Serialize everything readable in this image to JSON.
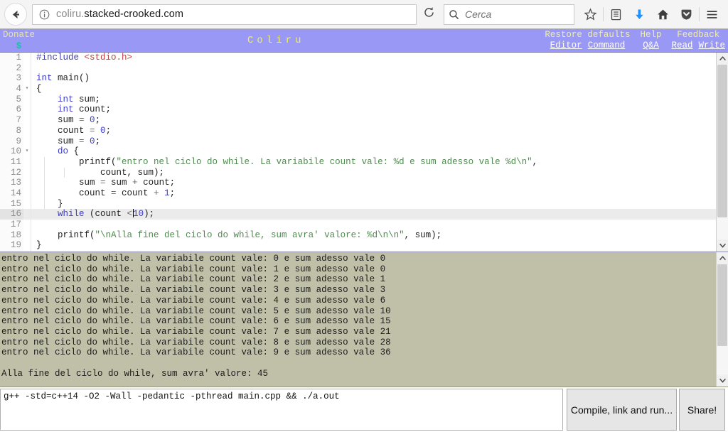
{
  "browser": {
    "back_title": "Back",
    "info_title": "Site information",
    "url_prefix": "coliru.",
    "url_domain": "stacked-crooked.com",
    "reload_title": "Reload",
    "search_placeholder": "Cerca",
    "icons": [
      {
        "name": "bookmark-star-icon",
        "title": "Bookmark this page"
      },
      {
        "name": "library-icon",
        "title": "Library"
      },
      {
        "name": "downloads-icon",
        "title": "Downloads"
      },
      {
        "name": "home-icon",
        "title": "Home"
      },
      {
        "name": "pocket-shield-icon",
        "title": "Save to Pocket"
      },
      {
        "name": "menu-hamburger-icon",
        "title": "Open menu"
      }
    ]
  },
  "coliru": {
    "donate_label": "Donate",
    "donate_symbol": "$",
    "title": "Coliru",
    "restore_defaults_label": "Restore defaults",
    "restore_editor": "Editor",
    "restore_command": "Command",
    "help_label": "Help",
    "help_qa": "Q&A",
    "feedback_label": "Feedback",
    "feedback_read": "Read",
    "feedback_write": "Write"
  },
  "editor": {
    "active_line": 16,
    "fold_lines": [
      4,
      10
    ],
    "lines": [
      {
        "n": 1,
        "tokens": [
          {
            "t": "#include ",
            "c": "tok-pre"
          },
          {
            "t": "<stdio.h>",
            "c": "tok-inc"
          }
        ]
      },
      {
        "n": 2,
        "tokens": []
      },
      {
        "n": 3,
        "tokens": [
          {
            "t": "int",
            "c": "tok-kw"
          },
          {
            "t": " main()",
            "c": ""
          }
        ]
      },
      {
        "n": 4,
        "tokens": [
          {
            "t": "{",
            "c": ""
          }
        ]
      },
      {
        "n": 5,
        "tokens": [
          {
            "t": "    ",
            "c": ""
          },
          {
            "t": "int",
            "c": "tok-kw"
          },
          {
            "t": " sum;",
            "c": ""
          }
        ]
      },
      {
        "n": 6,
        "tokens": [
          {
            "t": "    ",
            "c": ""
          },
          {
            "t": "int",
            "c": "tok-kw"
          },
          {
            "t": " count;",
            "c": ""
          }
        ]
      },
      {
        "n": 7,
        "tokens": [
          {
            "t": "    sum ",
            "c": ""
          },
          {
            "t": "=",
            "c": "tok-op"
          },
          {
            "t": " ",
            "c": ""
          },
          {
            "t": "0",
            "c": "tok-num"
          },
          {
            "t": ";",
            "c": ""
          }
        ]
      },
      {
        "n": 8,
        "tokens": [
          {
            "t": "    count ",
            "c": ""
          },
          {
            "t": "=",
            "c": "tok-op"
          },
          {
            "t": " ",
            "c": ""
          },
          {
            "t": "0",
            "c": "tok-num"
          },
          {
            "t": ";",
            "c": ""
          }
        ]
      },
      {
        "n": 9,
        "tokens": [
          {
            "t": "    sum ",
            "c": ""
          },
          {
            "t": "=",
            "c": "tok-op"
          },
          {
            "t": " ",
            "c": ""
          },
          {
            "t": "0",
            "c": "tok-num"
          },
          {
            "t": ";",
            "c": ""
          }
        ]
      },
      {
        "n": 10,
        "tokens": [
          {
            "t": "    ",
            "c": ""
          },
          {
            "t": "do",
            "c": "tok-kw"
          },
          {
            "t": " {",
            "c": ""
          }
        ]
      },
      {
        "n": 11,
        "tokens": [
          {
            "t": "        printf(",
            "c": ""
          },
          {
            "t": "\"entro nel ciclo do while. La variabile count vale: %d e sum adesso vale %d\\n\"",
            "c": "tok-str"
          },
          {
            "t": ",",
            "c": ""
          }
        ]
      },
      {
        "n": 12,
        "tokens": [
          {
            "t": "            count, sum);",
            "c": ""
          }
        ]
      },
      {
        "n": 13,
        "tokens": [
          {
            "t": "        sum ",
            "c": ""
          },
          {
            "t": "=",
            "c": "tok-op"
          },
          {
            "t": " sum ",
            "c": ""
          },
          {
            "t": "+",
            "c": "tok-op"
          },
          {
            "t": " count;",
            "c": ""
          }
        ]
      },
      {
        "n": 14,
        "tokens": [
          {
            "t": "        count ",
            "c": ""
          },
          {
            "t": "=",
            "c": "tok-op"
          },
          {
            "t": " count ",
            "c": ""
          },
          {
            "t": "+",
            "c": "tok-op"
          },
          {
            "t": " ",
            "c": ""
          },
          {
            "t": "1",
            "c": "tok-num"
          },
          {
            "t": ";",
            "c": ""
          }
        ]
      },
      {
        "n": 15,
        "tokens": [
          {
            "t": "    }",
            "c": ""
          }
        ]
      },
      {
        "n": 16,
        "tokens": [
          {
            "t": "    ",
            "c": ""
          },
          {
            "t": "while",
            "c": "tok-kw"
          },
          {
            "t": " (count ",
            "c": ""
          },
          {
            "t": "<",
            "c": "tok-op"
          },
          {
            "t": "|CARET|",
            "c": ""
          },
          {
            "t": "10",
            "c": "tok-num"
          },
          {
            "t": ");",
            "c": ""
          }
        ]
      },
      {
        "n": 17,
        "tokens": []
      },
      {
        "n": 18,
        "tokens": [
          {
            "t": "    printf(",
            "c": ""
          },
          {
            "t": "\"\\nAlla fine del ciclo do while, sum avra' valore: %d\\n\\n\"",
            "c": "tok-str"
          },
          {
            "t": ", sum);",
            "c": ""
          }
        ]
      },
      {
        "n": 19,
        "tokens": [
          {
            "t": "}",
            "c": ""
          }
        ]
      }
    ]
  },
  "output": {
    "lines": [
      "entro nel ciclo do while. La variabile count vale: 0 e sum adesso vale 0",
      "entro nel ciclo do while. La variabile count vale: 1 e sum adesso vale 0",
      "entro nel ciclo do while. La variabile count vale: 2 e sum adesso vale 1",
      "entro nel ciclo do while. La variabile count vale: 3 e sum adesso vale 3",
      "entro nel ciclo do while. La variabile count vale: 4 e sum adesso vale 6",
      "entro nel ciclo do while. La variabile count vale: 5 e sum adesso vale 10",
      "entro nel ciclo do while. La variabile count vale: 6 e sum adesso vale 15",
      "entro nel ciclo do while. La variabile count vale: 7 e sum adesso vale 21",
      "entro nel ciclo do while. La variabile count vale: 8 e sum adesso vale 28",
      "entro nel ciclo do while. La variabile count vale: 9 e sum adesso vale 36",
      "",
      "Alla fine del ciclo do while, sum avra' valore: 45"
    ]
  },
  "command": {
    "value": "g++ -std=c++14 -O2 -Wall -pedantic -pthread main.cpp && ./a.out"
  },
  "buttons": {
    "run_label": "Compile, link and run...",
    "share_label": "Share!"
  },
  "colors": {
    "header_bg": "#9999f5",
    "title_yellow": "#f2f24a",
    "output_bg": "#c0c0a8",
    "string_green": "#4f8a4f",
    "keyword_blue": "#3c3cc8",
    "include_red": "#c04040",
    "download_blue": "#1f90ff"
  }
}
